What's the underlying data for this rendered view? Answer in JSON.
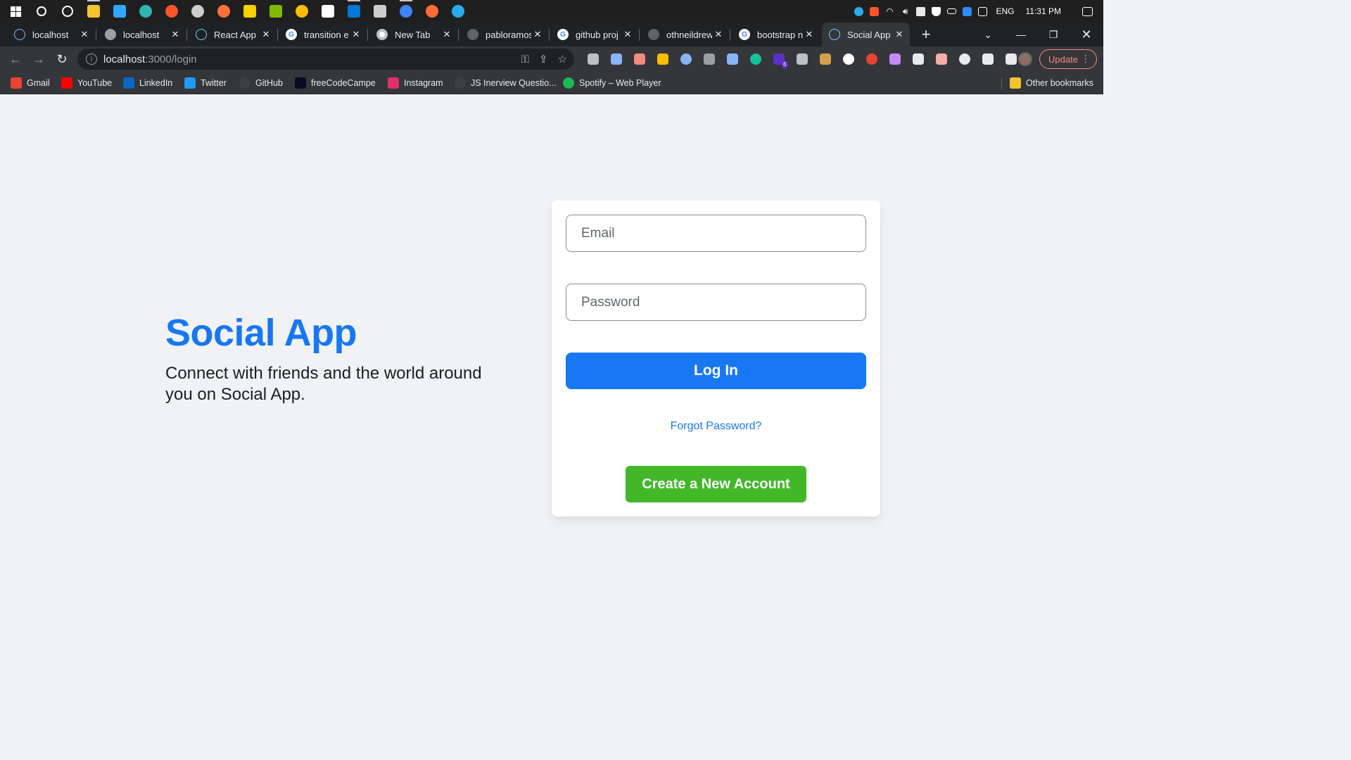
{
  "taskbar": {
    "apps": [
      {
        "icon": "windows-start-icon",
        "color": "#ffffff",
        "active": false
      },
      {
        "icon": "search-icon",
        "color": "#ffffff",
        "active": false
      },
      {
        "icon": "cortana-icon",
        "color": "#ffffff",
        "active": false
      },
      {
        "icon": "file-explorer-icon",
        "color": "#f4c430",
        "active": true
      },
      {
        "icon": "photoshop-icon",
        "color": "#31a8ff",
        "active": false
      },
      {
        "icon": "edge-icon",
        "color": "#2fb5b0",
        "active": false
      },
      {
        "icon": "brave-icon",
        "color": "#fb542b",
        "active": false
      },
      {
        "icon": "obs-icon",
        "color": "#cccccc",
        "active": false
      },
      {
        "icon": "firefox-icon",
        "color": "#ff7139",
        "active": false
      },
      {
        "icon": "sticky-notes-icon",
        "color": "#f7d000",
        "active": false
      },
      {
        "icon": "notepad-icon",
        "color": "#7fba00",
        "active": false
      },
      {
        "icon": "chrome-icon",
        "color": "#fbbc05",
        "active": false
      },
      {
        "icon": "notion-icon",
        "color": "#ffffff",
        "active": false
      },
      {
        "icon": "vscode-icon",
        "color": "#0078d4",
        "active": true
      },
      {
        "icon": "terminal-icon",
        "color": "#cccccc",
        "active": false
      },
      {
        "icon": "chrome-dev-icon",
        "color": "#4285f4",
        "active": true
      },
      {
        "icon": "postman-icon",
        "color": "#ff6c37",
        "active": false
      },
      {
        "icon": "telegram-icon",
        "color": "#2aabee",
        "active": false
      }
    ],
    "tray": {
      "language": "ENG",
      "time": "11:31 PM"
    }
  },
  "tabs": [
    {
      "title": "localhost",
      "favicon": "react-icon",
      "color": "#8ab4f8",
      "active": false
    },
    {
      "title": "localhost",
      "favicon": "globe-icon",
      "color": "#9aa0a6",
      "active": false
    },
    {
      "title": "React App",
      "favicon": "react-icon",
      "color": "#61dafb",
      "active": false
    },
    {
      "title": "transition e",
      "favicon": "google-icon",
      "color": "#ffffff",
      "active": false
    },
    {
      "title": "New Tab",
      "favicon": "chrome-icon",
      "color": "#ffffff",
      "active": false
    },
    {
      "title": "pabloramos",
      "favicon": "github-icon",
      "color": "#5f6368",
      "active": false
    },
    {
      "title": "github proj",
      "favicon": "google-icon",
      "color": "#ffffff",
      "active": false
    },
    {
      "title": "othneildrew",
      "favicon": "github-icon",
      "color": "#5f6368",
      "active": false
    },
    {
      "title": "bootstrap n",
      "favicon": "google-icon",
      "color": "#ffffff",
      "active": false
    },
    {
      "title": "Social App",
      "favicon": "react-icon",
      "color": "#61dafb",
      "active": true
    }
  ],
  "toolbar": {
    "url_host": "localhost",
    "url_path": ":3000/login",
    "update_label": "Update",
    "extensions": [
      "camera-icon",
      "download-icon",
      "code-icon",
      "color-wheel-icon",
      "c-icon",
      "bottle-icon",
      "pen-icon",
      "grammarly-icon",
      "puzzle-badge-icon",
      "font-icon",
      "n-icon",
      "circle-icon",
      "red-hand-icon",
      "feather-icon",
      "droplet-icon",
      "calendar-icon",
      "target-icon",
      "extensions-puzzle-icon",
      "side-panel-icon"
    ],
    "extension_badge": "6"
  },
  "bookmarks": [
    {
      "label": "Gmail",
      "icon": "gmail-icon",
      "color": "#ea4335"
    },
    {
      "label": "YouTube",
      "icon": "youtube-icon",
      "color": "#ff0000"
    },
    {
      "label": "LinkedIn",
      "icon": "linkedin-icon",
      "color": "#0a66c2"
    },
    {
      "label": "Twitter",
      "icon": "twitter-icon",
      "color": "#1d9bf0"
    },
    {
      "label": "GitHub",
      "icon": "github-icon",
      "color": "#3c4043"
    },
    {
      "label": "freeCodeCampe",
      "icon": "freecodecamp-icon",
      "color": "#0a0a23"
    },
    {
      "label": "Instagram",
      "icon": "instagram-icon",
      "color": "#e1306c"
    },
    {
      "label": "JS Inerview Questio...",
      "icon": "github-icon",
      "color": "#3c4043"
    },
    {
      "label": "Spotify – Web Player",
      "icon": "spotify-icon",
      "color": "#1db954"
    }
  ],
  "other_bookmarks": "Other bookmarks",
  "page": {
    "brand_title": "Social App",
    "tagline": "Connect with friends and the world around you on Social App.",
    "email_placeholder": "Email",
    "password_placeholder": "Password",
    "login_label": "Log In",
    "forgot_label": "Forgot Password?",
    "create_label": "Create a New Account",
    "colors": {
      "primary": "#1877f2",
      "success": "#42b72a",
      "background": "#f0f2f5"
    }
  }
}
